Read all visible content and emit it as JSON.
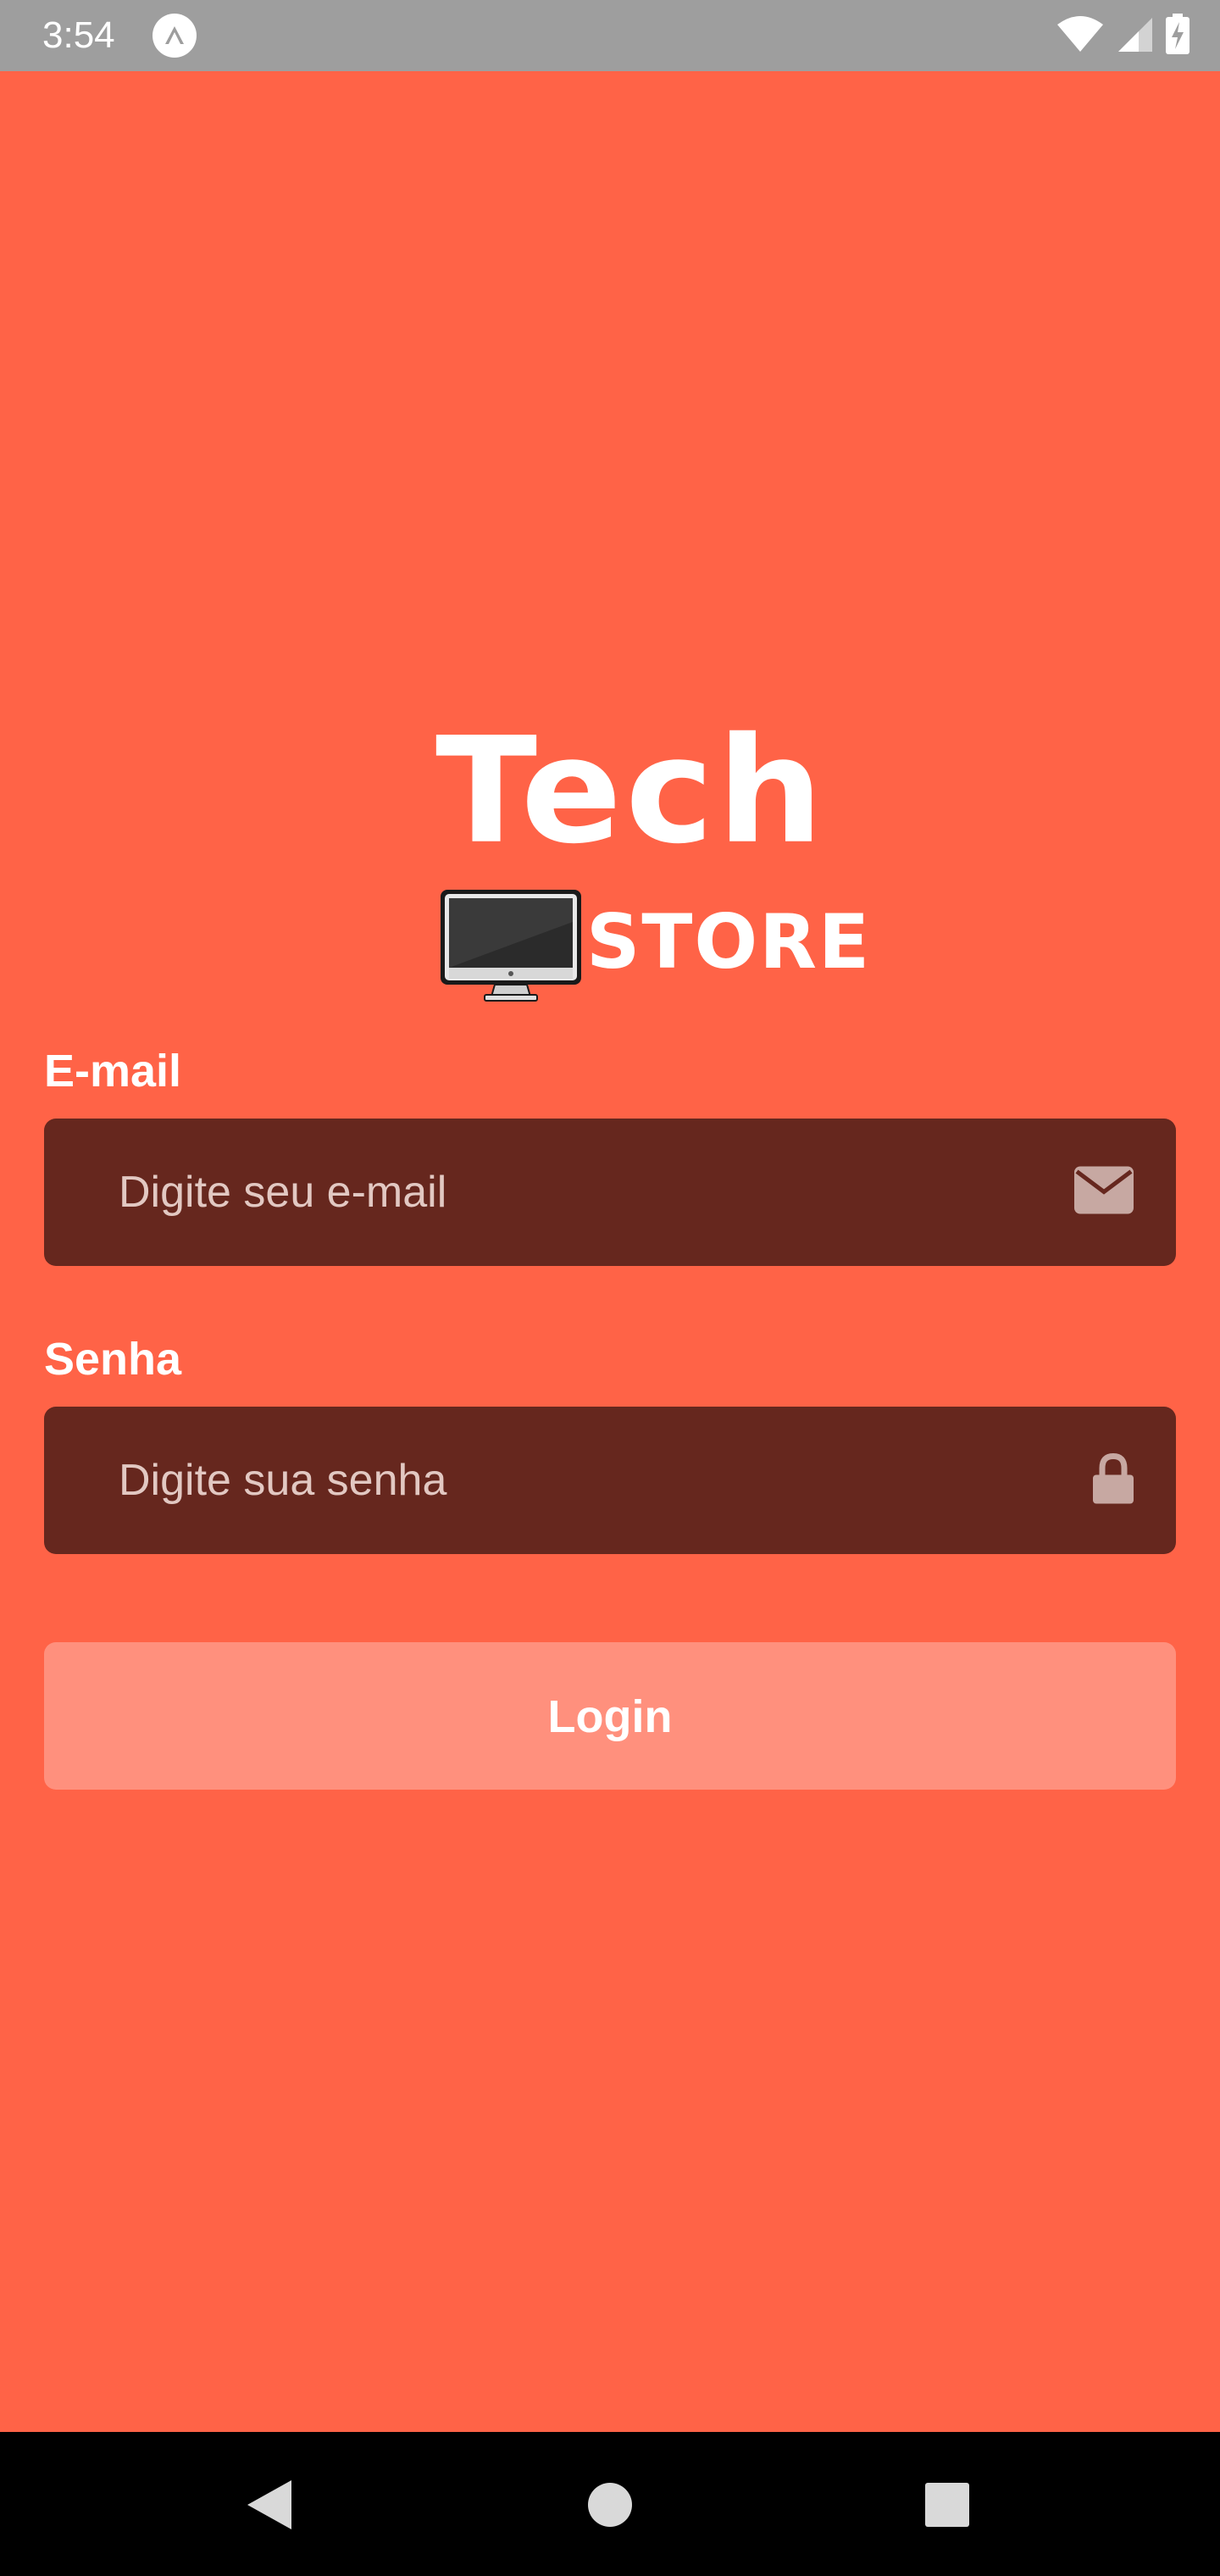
{
  "status_bar": {
    "time": "3:54",
    "app_icon": "expo-icon",
    "wifi_icon": "wifi-icon",
    "signal_icon": "cell-signal-icon",
    "battery_icon": "battery-charging-icon"
  },
  "logo": {
    "line1": "Tech",
    "line2": "STORE",
    "image_icon": "computer-monitor-icon"
  },
  "form": {
    "email": {
      "label": "E-mail",
      "placeholder": "Digite seu e-mail",
      "value": "",
      "icon": "envelope-icon"
    },
    "password": {
      "label": "Senha",
      "placeholder": "Digite sua senha",
      "value": "",
      "icon": "lock-icon"
    },
    "login_button": "Login"
  },
  "nav_bar": {
    "back_icon": "back-triangle-icon",
    "home_icon": "home-circle-icon",
    "recents_icon": "recents-square-icon"
  },
  "colors": {
    "background": "#ff6347",
    "input_background": "#66271e",
    "button_background": "#ff907d",
    "status_bar": "#9e9e9e",
    "nav_bar": "#000000",
    "text": "#ffffff"
  }
}
